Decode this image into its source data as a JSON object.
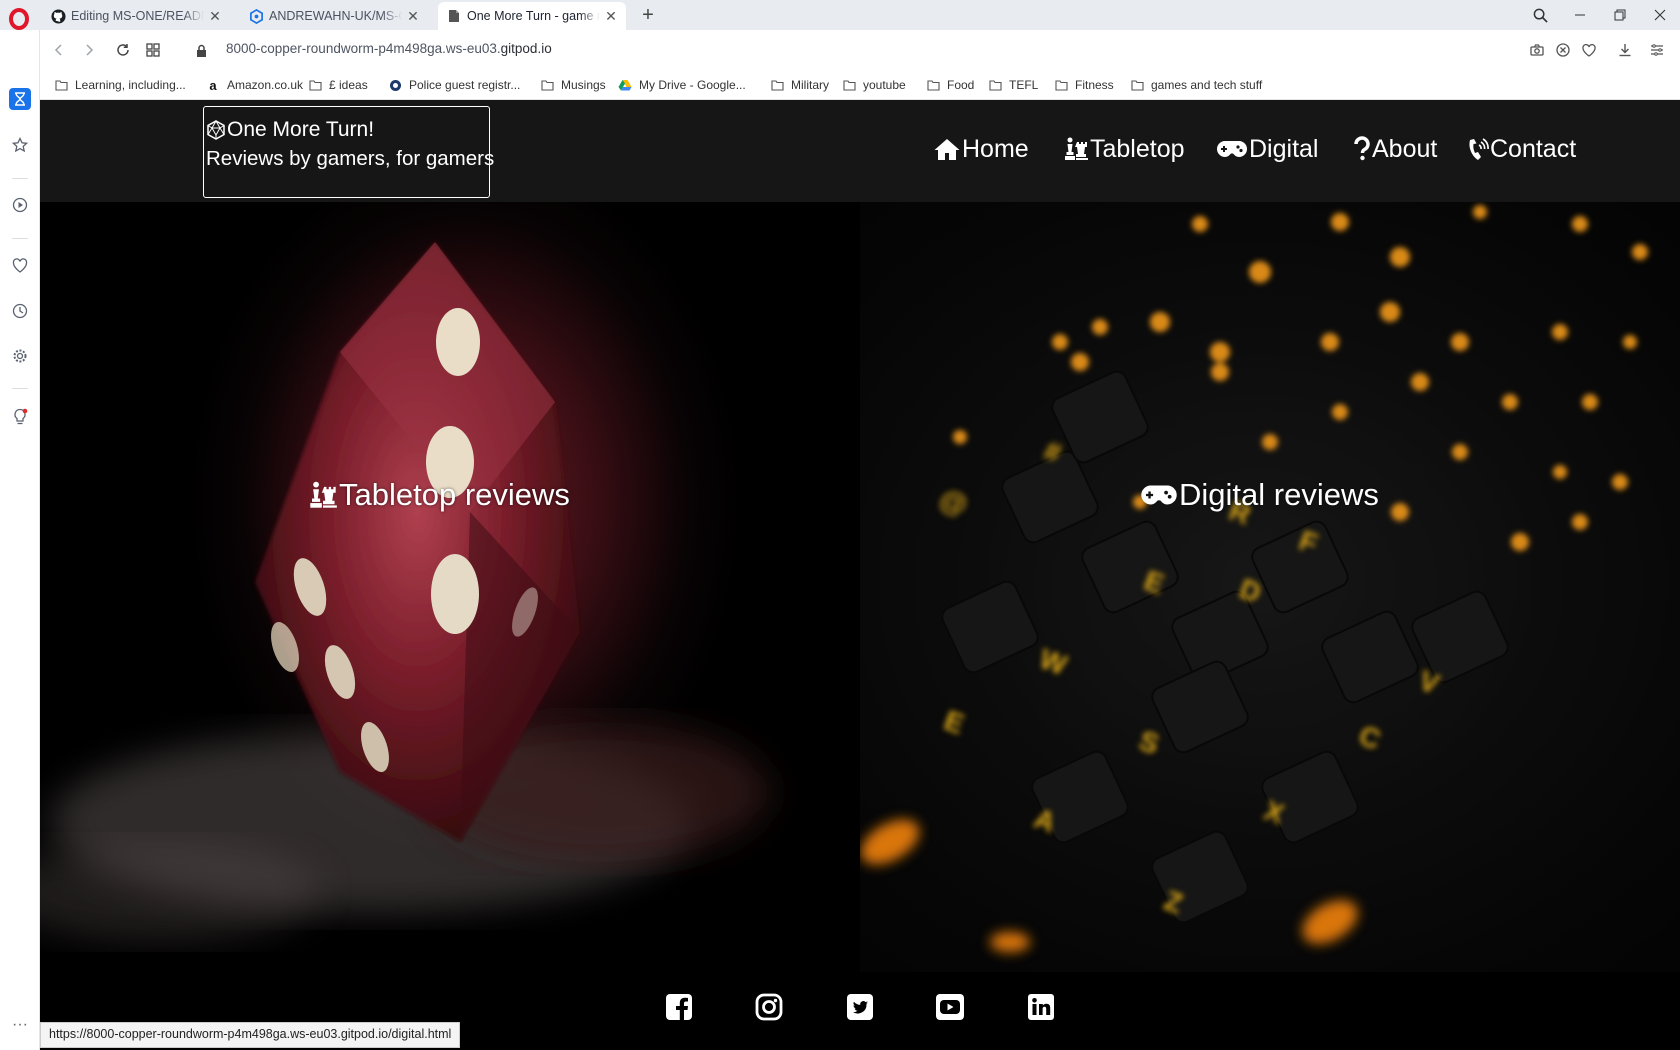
{
  "browser": {
    "tabs": [
      {
        "label": "Editing MS-ONE/README.md",
        "icon": "github-icon",
        "active": false
      },
      {
        "label": "ANDREWAHN-UK/MS-ONE",
        "icon": "gitpod-icon",
        "active": false
      },
      {
        "label": "One More Turn - game reviews",
        "icon": "page-icon",
        "active": true
      }
    ],
    "url": {
      "host_prefix": "8000-copper-roundworm-p4m498ga.ws-eu03.",
      "host_main": "gitpod.io"
    },
    "bookmarks": [
      {
        "label": "Learning, including...",
        "icon": "folder-icon"
      },
      {
        "label": "Amazon.co.uk",
        "icon": "amazon-icon"
      },
      {
        "label": "£ ideas",
        "icon": "folder-icon"
      },
      {
        "label": "Police guest registr...",
        "icon": "police-icon"
      },
      {
        "label": "Musings",
        "icon": "folder-icon"
      },
      {
        "label": "My Drive - Google...",
        "icon": "google-drive-icon"
      },
      {
        "label": "Military",
        "icon": "folder-icon"
      },
      {
        "label": "youtube",
        "icon": "folder-icon"
      },
      {
        "label": "Food",
        "icon": "folder-icon"
      },
      {
        "label": "TEFL",
        "icon": "folder-icon"
      },
      {
        "label": "Fitness",
        "icon": "folder-icon"
      },
      {
        "label": "games and tech stuff",
        "icon": "folder-icon"
      }
    ],
    "status_url": "https://8000-copper-roundworm-p4m498ga.ws-eu03.gitpod.io/digital.html",
    "accent": "#1a73e8"
  },
  "site": {
    "brand_title": "One More Turn!",
    "brand_tagline": "Reviews by gamers, for gamers",
    "nav": [
      {
        "label": "Home",
        "icon": "home-icon"
      },
      {
        "label": "Tabletop",
        "icon": "chess-icon"
      },
      {
        "label": "Digital",
        "icon": "gamepad-icon"
      },
      {
        "label": "About",
        "icon": "question-icon"
      },
      {
        "label": "Contact",
        "icon": "phone-icon"
      }
    ],
    "hero_left_label": "Tabletop reviews",
    "hero_right_label": "Digital reviews",
    "social": [
      "facebook-icon",
      "instagram-icon",
      "twitter-icon",
      "youtube-icon",
      "linkedin-icon"
    ],
    "header_bg": "#161616",
    "text_color": "#ffffff"
  }
}
